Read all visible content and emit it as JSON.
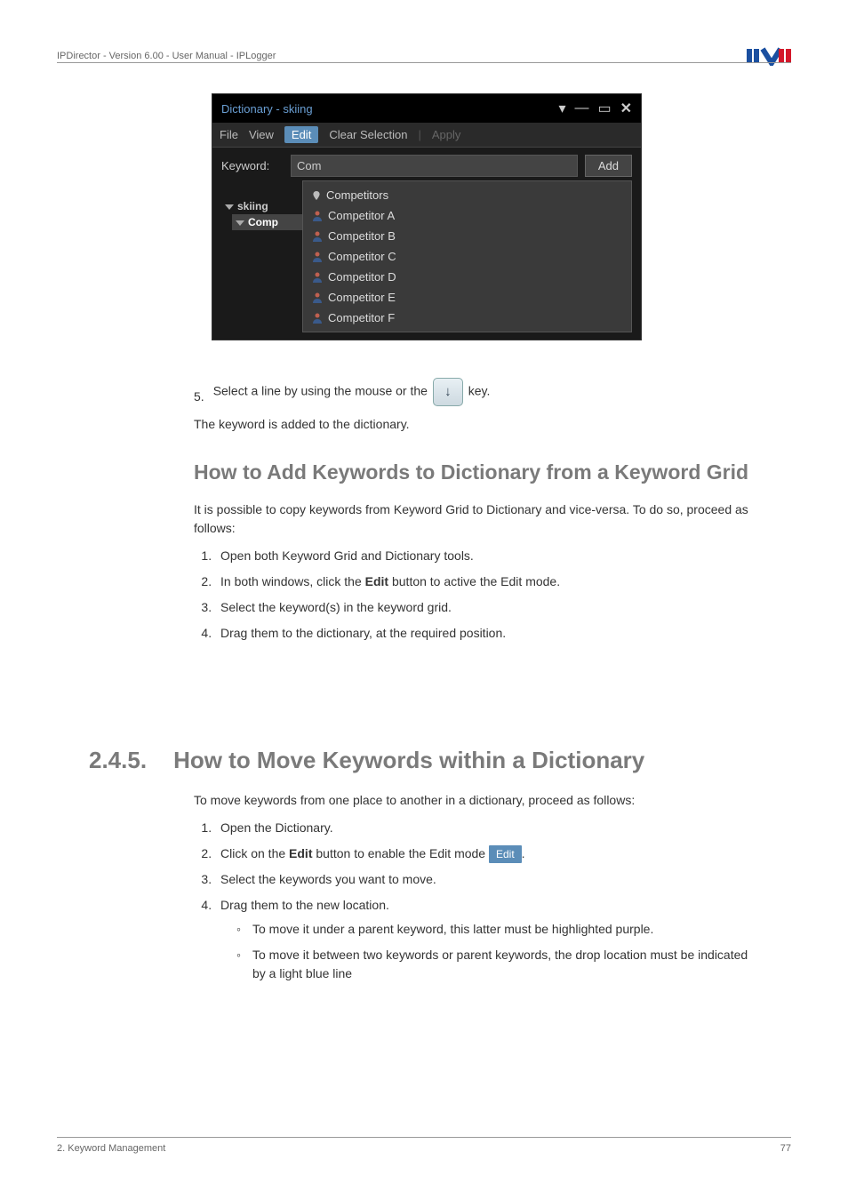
{
  "header": {
    "left": "IPDirector - Version 6.00 - User Manual - IPLogger"
  },
  "dictWindow": {
    "title": "Dictionary - skiing",
    "menu": {
      "file": "File",
      "view": "View",
      "edit": "Edit",
      "clear": "Clear Selection",
      "apply": "Apply"
    },
    "keywordLabel": "Keyword:",
    "keywordValue": "Com",
    "addLabel": "Add",
    "tree": {
      "root": "skiing",
      "selected": "Comp"
    },
    "dropdown": [
      "Competitors",
      "Competitor A",
      "Competitor B",
      "Competitor C",
      "Competitor D",
      "Competitor E",
      "Competitor F"
    ]
  },
  "step5": {
    "num": "5.",
    "before": "Select a line by using the mouse or the ",
    "after": " key."
  },
  "afterStep5": "The keyword is added to the dictionary.",
  "h2a": "How to Add Keywords to Dictionary from a Keyword Grid",
  "paraA": "It is possible to copy keywords from Keyword Grid to Dictionary and vice-versa. To do so, proceed as follows:",
  "stepsA": [
    "Open both Keyword Grid and Dictionary tools.",
    "In both windows, click the Edit button to active the Edit mode.",
    "Select the keyword(s) in the keyword grid.",
    "Drag them to the dictionary, at the required position."
  ],
  "stepsA_bold": "Edit",
  "section": {
    "num": "2.4.5.",
    "title": "How to Move Keywords within a Dictionary"
  },
  "paraB": "To move keywords from one place to another in a dictionary, proceed as follows:",
  "stepsB": {
    "s1": "Open the Dictionary.",
    "s2a": "Click on the ",
    "s2bold": "Edit",
    "s2b": " button to enable the Edit mode ",
    "s2btn": "Edit",
    "s2c": ".",
    "s3": "Select the keywords you want to move.",
    "s4": "Drag them to the new location.",
    "sub1": "To move it under a parent keyword, this latter must be highlighted purple.",
    "sub2": "To move it between two keywords or parent keywords, the drop location must be indicated by a light blue line"
  },
  "footer": {
    "left": "2. Keyword Management",
    "right": "77"
  }
}
